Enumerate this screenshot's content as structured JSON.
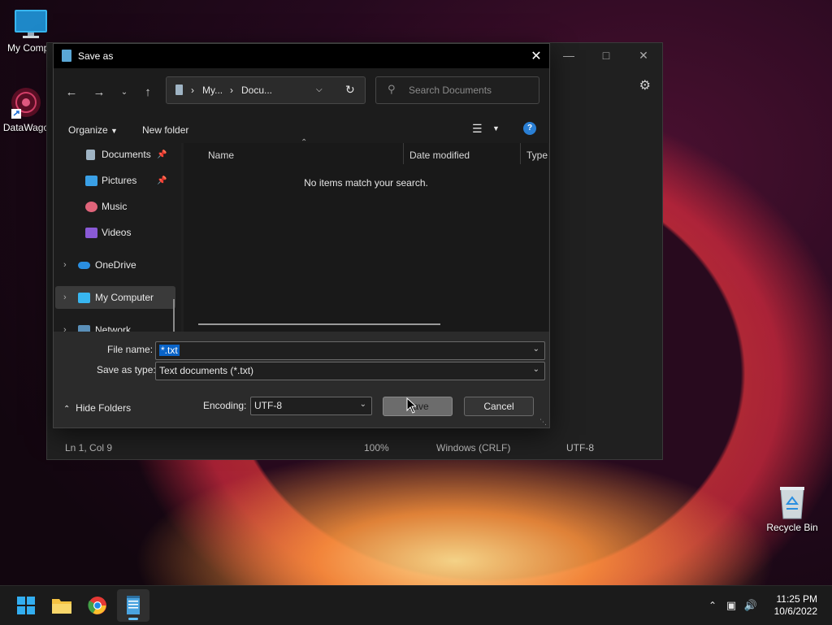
{
  "desktop": {
    "icons": [
      {
        "label": "My Compu"
      },
      {
        "label": "DataWago"
      },
      {
        "label": "Recycle Bin"
      }
    ]
  },
  "notepad": {
    "status": {
      "position": "Ln 1, Col 9",
      "zoom": "100%",
      "line_ending": "Windows (CRLF)",
      "encoding": "UTF-8"
    }
  },
  "dialog": {
    "title": "Save as",
    "address": {
      "seg1": "My...",
      "seg2": "Docu..."
    },
    "search_placeholder": "Search Documents",
    "toolbar": {
      "organize": "Organize",
      "new_folder": "New folder"
    },
    "sidebar": [
      {
        "label": "Documents"
      },
      {
        "label": "Pictures"
      },
      {
        "label": "Music"
      },
      {
        "label": "Videos"
      },
      {
        "label": "OneDrive"
      },
      {
        "label": "My Computer"
      },
      {
        "label": "Network"
      }
    ],
    "columns": {
      "name": "Name",
      "date": "Date modified",
      "type": "Type"
    },
    "empty_message": "No items match your search.",
    "file_name_label": "File name:",
    "file_name_value": "*.txt",
    "save_type_label": "Save as type:",
    "save_type_value": "Text documents (*.txt)",
    "hide_folders": "Hide Folders",
    "encoding_label": "Encoding:",
    "encoding_value": "UTF-8",
    "save_label": "Save",
    "cancel_label": "Cancel"
  },
  "taskbar": {
    "time": "11:25 PM",
    "date": "10/6/2022"
  },
  "colors": {
    "accent": "#0a64c8",
    "dialog_bg": "#202020",
    "taskbar_bg": "#1b1b1b"
  }
}
